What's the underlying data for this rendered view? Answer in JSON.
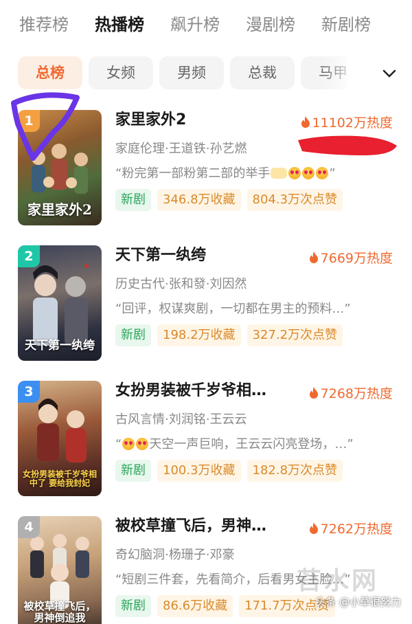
{
  "top_tabs": [
    {
      "label": "推荐榜",
      "active": false
    },
    {
      "label": "热播榜",
      "active": true
    },
    {
      "label": "飙升榜",
      "active": false
    },
    {
      "label": "漫剧榜",
      "active": false
    },
    {
      "label": "新剧榜",
      "active": false
    }
  ],
  "filters": [
    {
      "label": "总榜",
      "active": true
    },
    {
      "label": "女频",
      "active": false
    },
    {
      "label": "男频",
      "active": false
    },
    {
      "label": "总裁",
      "active": false
    },
    {
      "label": "马甲",
      "active": false
    }
  ],
  "expand_icon": "chevron-down-icon",
  "items": [
    {
      "rank": "1",
      "badge_color": "#f5a040",
      "poster_text": "家里家外2",
      "title": "家里家外2",
      "heat": "11102万热度",
      "meta": "家庭伦理·王道铁·孙艺燃",
      "quote_open": "“粉完第一部粉第二部的举手",
      "quote_close": "”",
      "tag_new": "新剧",
      "favorites": "346.8万收藏",
      "likes": "804.3万次点赞"
    },
    {
      "rank": "2",
      "badge_color": "#1fc7a8",
      "poster_text": "天下第一纨绔",
      "title": "天下第一纨绔",
      "heat": "7669万热度",
      "meta": "历史古代·张和發·刘因然",
      "quote": "“回评，权谋爽剧，一切都在男主的预料…”",
      "tag_new": "新剧",
      "favorites": "198.2万收藏",
      "likes": "327.2万次点赞"
    },
    {
      "rank": "3",
      "badge_color": "#3b8ff0",
      "poster_text": "女扮男装被千岁爷相中了 要给我封妃",
      "title": "女扮男装被千岁爷相…",
      "heat": "7268万热度",
      "meta": "古风言情·刘润铭·王云云",
      "quote_rest": "天空一声巨响，王云云闪亮登场，…”",
      "tag_new": "新剧",
      "favorites": "100.3万收藏",
      "likes": "182.8万次点赞"
    },
    {
      "rank": "4",
      "badge_color": "#b0b0b0",
      "poster_text": "被校草撞飞后，男神倒追我",
      "title": "被校草撞飞后，男神…",
      "heat": "7262万热度",
      "meta": "奇幻脑洞·杨珊子·邓豪",
      "quote": "“短剧三件套，先看简介，后看男女主脸…”",
      "tag_new": "新剧",
      "favorites": "86.6万收藏",
      "likes": "171.7万次点赞"
    }
  ],
  "watermark": "头条 @小草很努力",
  "watermark_big": "苔水网",
  "colors": {
    "accent": "#f0692f",
    "annotation_purple": "#6a35e6",
    "annotation_red": "#e8202f"
  }
}
